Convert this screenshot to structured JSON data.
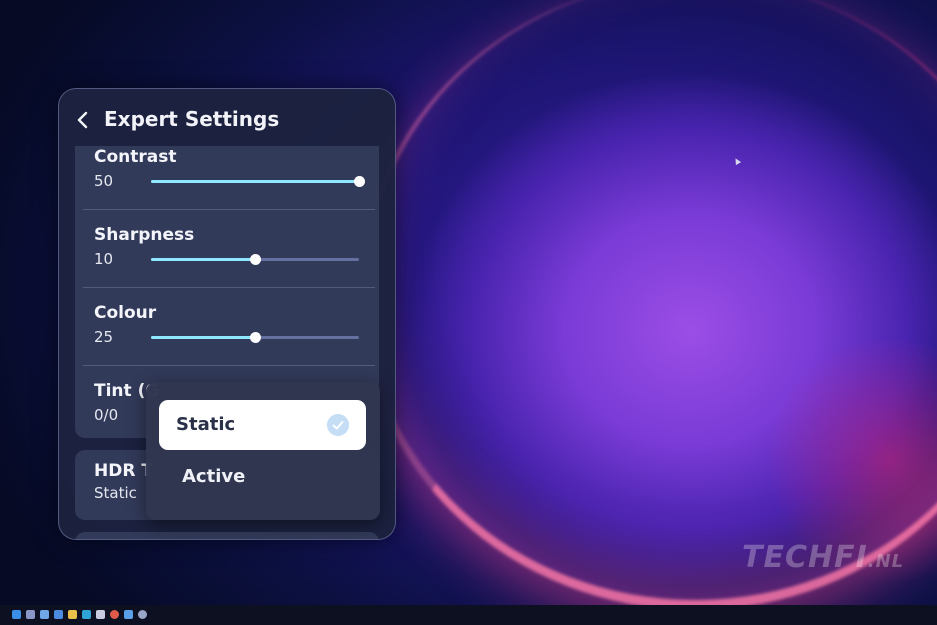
{
  "panel": {
    "title": "Expert Settings"
  },
  "settings": [
    {
      "label": "Contrast",
      "value": "50",
      "level": 1.0
    },
    {
      "label": "Sharpness",
      "value": "10",
      "level": 0.5
    },
    {
      "label": "Colour",
      "value": "25",
      "level": 0.5
    },
    {
      "label": "Tint (G",
      "value": "0/0"
    }
  ],
  "hdr": {
    "label": "HDR T",
    "value": "Static"
  },
  "dropdown": {
    "options": [
      {
        "label": "Static",
        "selected": true
      },
      {
        "label": "Active",
        "selected": false
      }
    ]
  },
  "watermark": {
    "main": "TECHFI",
    "suffix": ".NL"
  },
  "colors": {
    "slider_fill": "#8fe8ff",
    "slider_track": "#6670a0",
    "panel_bg": "#1c223e",
    "card_bg": "#323a5a",
    "check_bg": "#c5def5"
  },
  "taskbar_icons": [
    "start-icon",
    "search-icon",
    "task-view-icon",
    "widgets-icon",
    "file-explorer-icon",
    "edge-icon",
    "store-icon",
    "chrome-icon",
    "app-icon",
    "settings-icon"
  ]
}
